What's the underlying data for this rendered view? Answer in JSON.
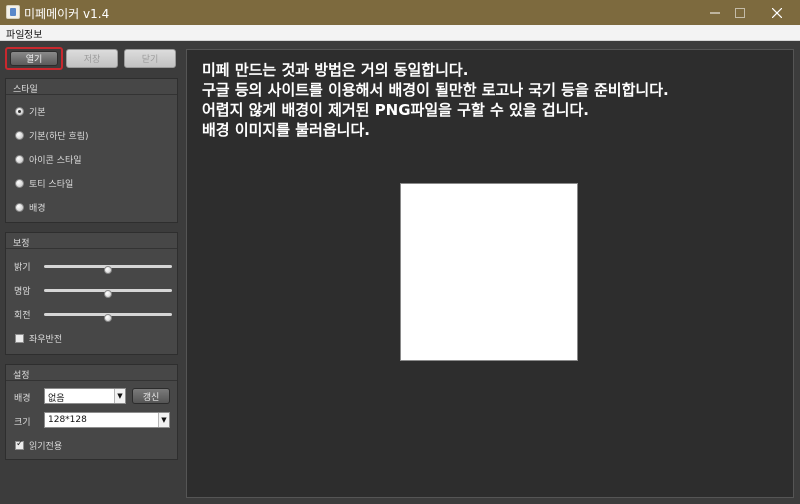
{
  "window": {
    "title": "미페메이커 v1.4",
    "controls": {
      "minimize": "—",
      "maximize": "☐",
      "close": "✕"
    }
  },
  "menu": {
    "file": "파일",
    "info": "정보"
  },
  "toolbar": {
    "open": "열기",
    "save": "저장",
    "close": "닫기"
  },
  "style_group": {
    "title": "스타일",
    "options": [
      "기본",
      "기본(하단 흐림)",
      "아이콘 스타일",
      "토티 스타일",
      "배경"
    ],
    "selected_index": 0
  },
  "adjust_group": {
    "title": "보정",
    "brightness_label": "밝기",
    "brightness_value": 0.5,
    "contrast_label": "명암",
    "contrast_value": 0.5,
    "rotate_label": "회전",
    "rotate_value": 0.5,
    "flip_label": "좌우반전",
    "flip_checked": false
  },
  "settings_group": {
    "title": "설정",
    "background_label": "배경",
    "background_value": "없음",
    "refresh_label": "갱신",
    "size_label": "크기",
    "size_value": "128*128",
    "readonly_label": "읽기전용",
    "readonly_checked": true
  },
  "instructions": [
    "미페 만드는 것과 방법은 거의 동일합니다.",
    "구글 등의 사이트를 이용해서 배경이 될만한 로고나 국기 등을 준비합니다.",
    "어렵지 않게 배경이 제거된 PNG파일을 구할 수 있을 겁니다.",
    "배경 이미지를 불러옵니다."
  ],
  "colors": {
    "titlebar": "#7d6a3e",
    "panel": "#474747",
    "main_bg": "#2d2d2d",
    "highlight": "#c8282e"
  }
}
